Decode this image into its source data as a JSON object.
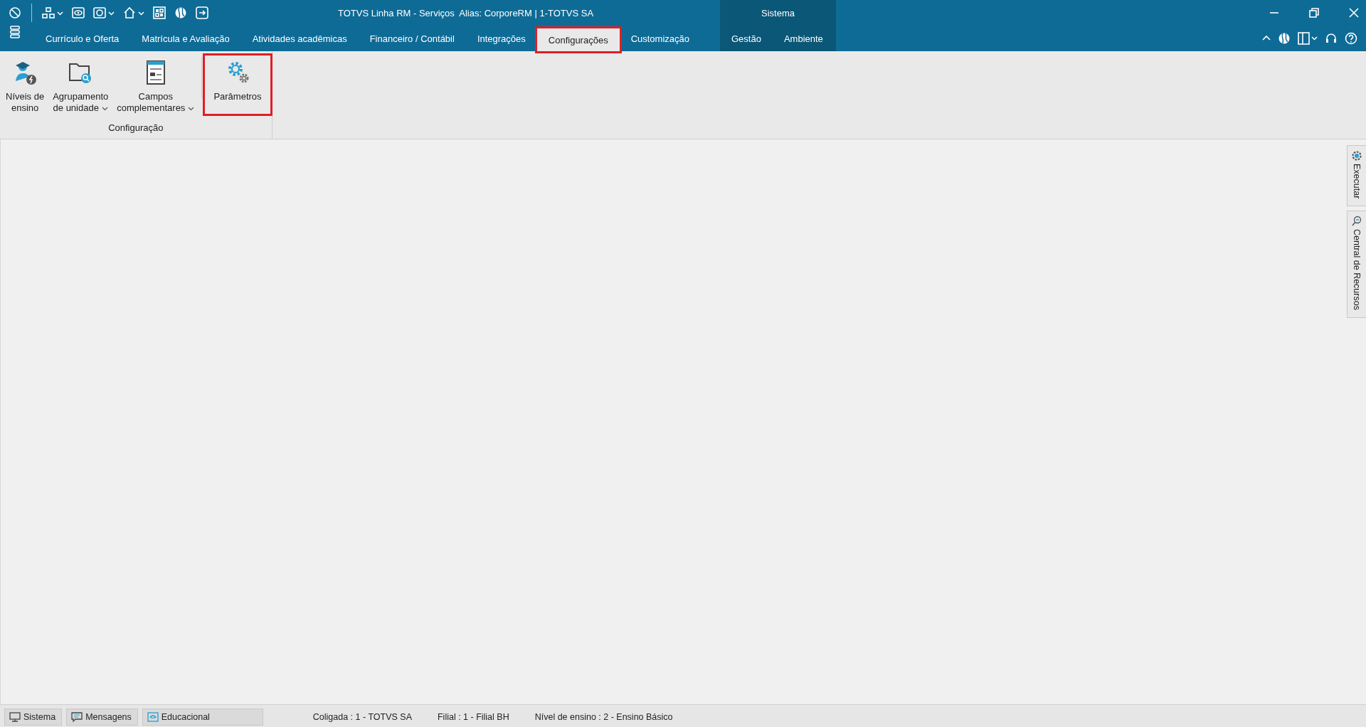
{
  "window": {
    "title": "TOTVS Linha RM - Serviços  Alias: CorporeRM | 1-TOTVS SA"
  },
  "tabs": [
    {
      "label": "Currículo e Oferta",
      "selected": false,
      "highlighted": false
    },
    {
      "label": "Matrícula e Avaliação",
      "selected": false,
      "highlighted": false
    },
    {
      "label": "Atividades acadêmicas",
      "selected": false,
      "highlighted": false
    },
    {
      "label": "Financeiro / Contábil",
      "selected": false,
      "highlighted": false
    },
    {
      "label": "Integrações",
      "selected": false,
      "highlighted": false
    },
    {
      "label": "Configurações",
      "selected": true,
      "highlighted": true
    },
    {
      "label": "Customização",
      "selected": false,
      "highlighted": false
    }
  ],
  "context_group": {
    "label": "Sistema",
    "tabs": [
      {
        "label": "Gestão",
        "selected": false
      },
      {
        "label": "Ambiente",
        "selected": false
      }
    ]
  },
  "ribbon": {
    "groups": [
      {
        "label": "Configuração",
        "buttons": [
          {
            "lines": [
              "Níveis de",
              "ensino"
            ],
            "dropdown": false,
            "separated": false,
            "highlighted": false
          },
          {
            "lines": [
              "Agrupamento",
              "de unidade"
            ],
            "dropdown": true,
            "separated": false,
            "highlighted": false
          },
          {
            "lines": [
              "Campos",
              "complementares"
            ],
            "dropdown": true,
            "separated": false,
            "highlighted": false
          },
          {
            "lines": [
              "Parâmetros"
            ],
            "dropdown": false,
            "separated": true,
            "highlighted": true
          }
        ]
      }
    ]
  },
  "side_panels": [
    {
      "label": "Executar"
    },
    {
      "label": "Central de Recursos"
    }
  ],
  "status_bar": {
    "buttons": [
      {
        "label": "Sistema"
      },
      {
        "label": "Mensagens"
      },
      {
        "label": "Educacional"
      }
    ],
    "info": [
      "Coligada : 1 - TOTVS SA",
      "Filial : 1 - Filial BH",
      "Nível de ensino : 2 - Ensino Básico"
    ]
  }
}
